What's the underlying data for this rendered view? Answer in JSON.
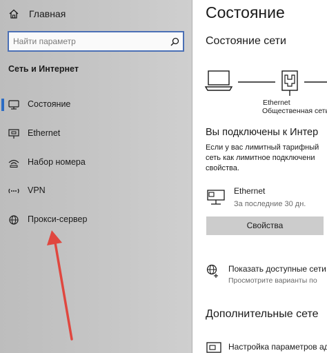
{
  "sidebar": {
    "home_label": "Главная",
    "search": {
      "placeholder": "Найти параметр"
    },
    "section_title": "Сеть и Интернет",
    "items": [
      {
        "label": "Состояние",
        "icon": "network-status-icon",
        "selected": true
      },
      {
        "label": "Ethernet",
        "icon": "ethernet-icon",
        "selected": false
      },
      {
        "label": "Набор номера",
        "icon": "dial-up-icon",
        "selected": false
      },
      {
        "label": "VPN",
        "icon": "vpn-icon",
        "selected": false
      },
      {
        "label": "Прокси-сервер",
        "icon": "globe-icon",
        "selected": false
      }
    ]
  },
  "main": {
    "title": "Состояние",
    "network_status_title": "Состояние сети",
    "diagram": {
      "adapter_label": "Ethernet",
      "network_type": "Общественная сеть"
    },
    "connected_title": "Вы подключены к Интер",
    "metered_lines": [
      "Если у вас лимитный тарифный",
      "сеть как лимитное подключени",
      "свойства."
    ],
    "connection": {
      "name": "Ethernet",
      "usage": "За последние 30 дн."
    },
    "properties_button": "Свойства",
    "show_networks": {
      "title": "Показать доступные сети",
      "subtitle": "Просмотрите варианты по"
    },
    "more_settings_title": "Дополнительные сете",
    "adapter_settings": "Настройка параметров ад"
  },
  "colors": {
    "accent": "#2b6cc4",
    "search_border": "#4a6fb5",
    "annotation_arrow": "#e0473f",
    "button_bg": "#cccccc"
  }
}
